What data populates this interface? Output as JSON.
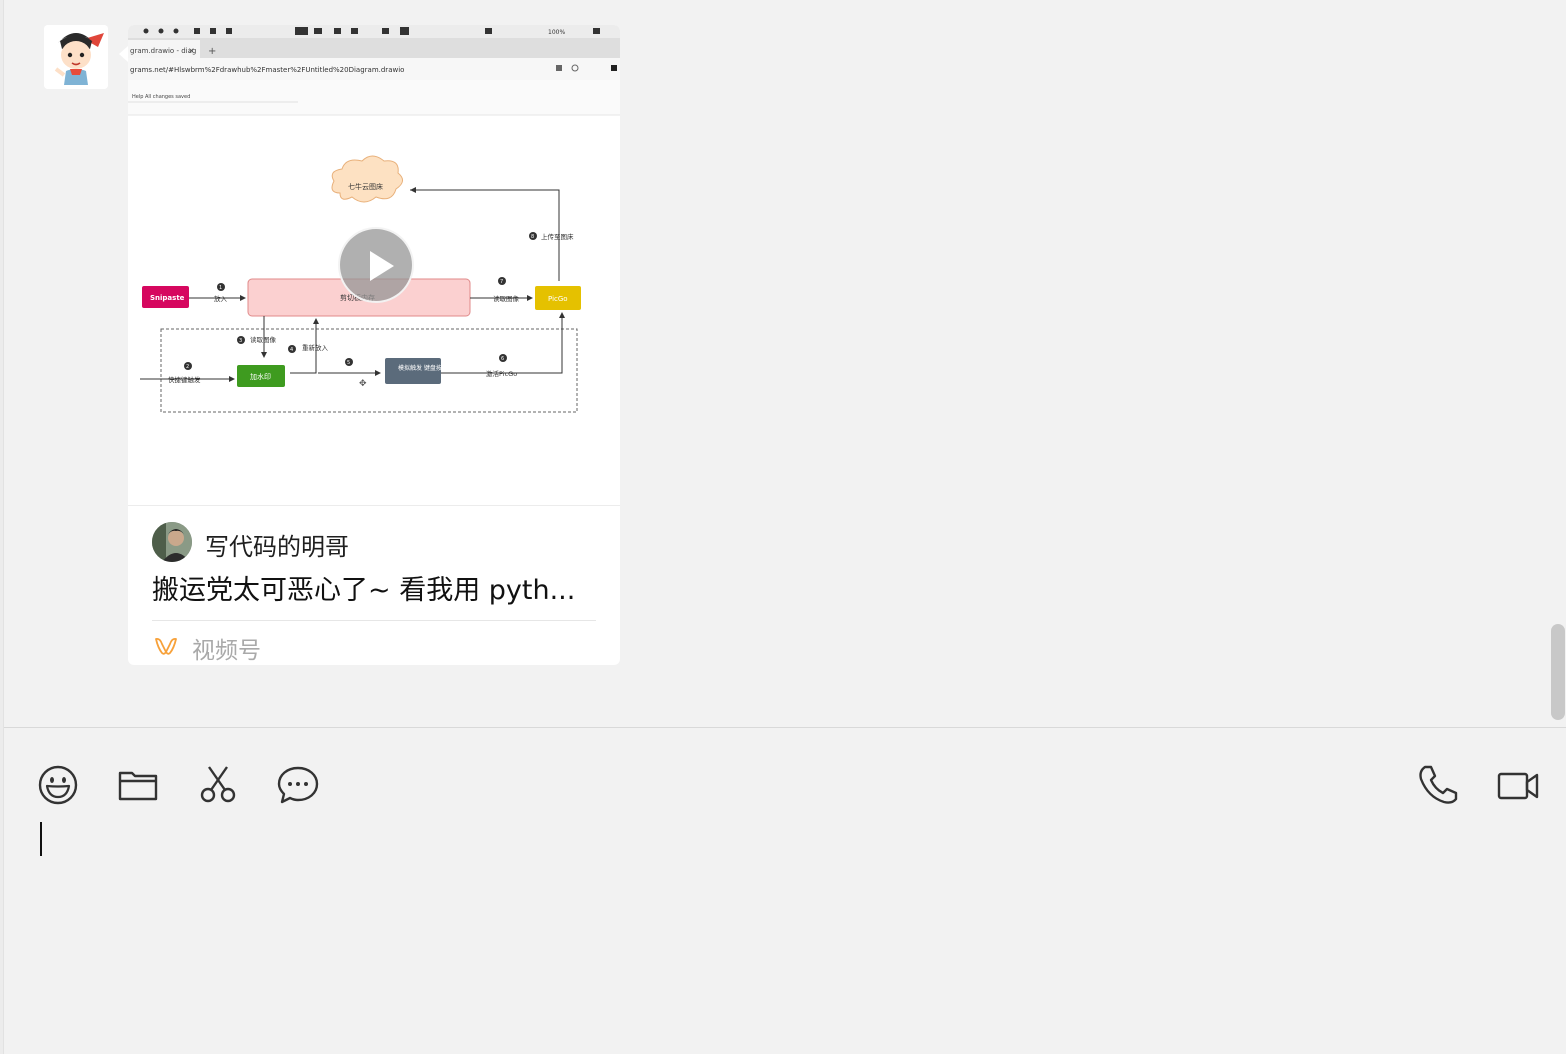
{
  "message": {
    "video_card": {
      "thumbnail_title": "七牛云图床",
      "author": "写代码的明哥",
      "title": "搬运党太可恶心了~ 看我用 pyth...",
      "channel": "视频号"
    }
  },
  "thumbnail": {
    "browser_tab": "gram.drawio - diag",
    "url": "grams.net/#Hlswbrm%2Fdrawhub%2Fmaster%2FUntitled%20Diagram.drawio",
    "menu": "Help   All changes saved",
    "nodes": {
      "cloud": "七牛云图床",
      "snipaste": "Snipaste",
      "clipboard": "剪切板内存",
      "picgo": "PicGo",
      "watermark": "加水印",
      "simulate": "模拟触发 键盘按键"
    },
    "edges": {
      "e1": "放入",
      "e2": "快捷键触发",
      "e3": "读取图像",
      "e4": "重新放入",
      "e6": "激活PicGo",
      "e7": "读取图像",
      "e8": "上传至图床"
    },
    "steps": [
      "1",
      "2",
      "3",
      "4",
      "5",
      "6",
      "7",
      "8"
    ]
  },
  "composer": {
    "input_value": "",
    "icons": [
      "emoji-icon",
      "folder-icon",
      "scissors-icon",
      "chat-bubble-icon",
      "phone-icon",
      "video-camera-icon"
    ]
  },
  "colors": {
    "background": "#f2f2f2",
    "card": "#ffffff",
    "channel_accent": "#f7a13a",
    "snipaste": "#d6075f",
    "picgo": "#e5c100",
    "watermark": "#3e9b1f",
    "simulate": "#5b6b7b"
  }
}
